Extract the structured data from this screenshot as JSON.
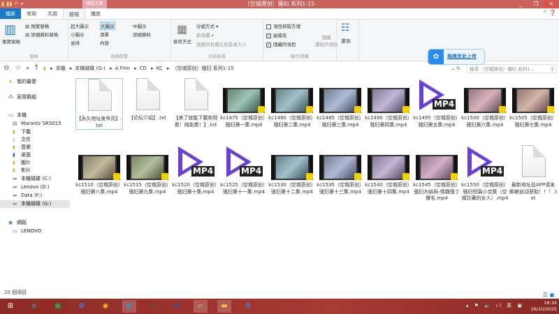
{
  "window": {
    "title": "（空城原创）骚妇 系列1-15",
    "context_tab": "視訊工具",
    "minimize": "_",
    "maximize": "❐",
    "close": "✕"
  },
  "tabs": [
    {
      "label": "檔案"
    },
    {
      "label": "常用"
    },
    {
      "label": "共用"
    },
    {
      "label": "檢視",
      "active": true
    },
    {
      "label": "播放"
    }
  ],
  "ribbon": {
    "pane": {
      "nav_pane": "瀏覽窗格",
      "preview": "預覽窗格",
      "details": "詳細資料窗格",
      "group": "窗格"
    },
    "layout": {
      "xl": "超大圖示",
      "large": "大圖示",
      "medium": "中圖示",
      "small": "小圖示",
      "list": "清單",
      "details": "詳細資料",
      "tiles": "並排",
      "content": "內容",
      "group": "版面配置",
      "selected": "大圖示"
    },
    "view": {
      "sort": "排序方式",
      "group_by": "分組方式 ▾",
      "add_col": "新增欄 ▾",
      "fit_cols": "調整所有欄位至最適大小",
      "group": "目前檢視"
    },
    "show": {
      "checkboxes": "項目核取方塊",
      "checkboxes_on": false,
      "ext": "副檔名",
      "ext_on": true,
      "hidden": "隱藏的項目",
      "hidden_on": true,
      "hide_sel": "隱藏",
      "hide_sel2": "選取的項目",
      "group": "顯示/隱藏"
    },
    "options": "選項"
  },
  "address": {
    "crumbs": [
      "本機",
      "本機磁碟 (G:)",
      "A Film",
      "CD",
      "KC",
      "（空城原创）骚妇 系列1-15"
    ],
    "search_placeholder": "搜尋 （空城原创）骚妇 系列1..."
  },
  "upload": {
    "label": "拖拽至此上传"
  },
  "sidebar": [
    {
      "label": "我的最愛",
      "icon": "star-icon"
    },
    {
      "label": "家用群組",
      "icon": "homegroup-icon"
    },
    {
      "label": "本機",
      "icon": "computer-icon"
    },
    {
      "label": "Marantz SR5015",
      "icon": "media-device-icon"
    },
    {
      "label": "下載",
      "icon": "downloads-icon"
    },
    {
      "label": "文件",
      "icon": "documents-icon"
    },
    {
      "label": "音樂",
      "icon": "music-icon"
    },
    {
      "label": "桌面",
      "icon": "desktop-icon"
    },
    {
      "label": "圖片",
      "icon": "pictures-icon"
    },
    {
      "label": "影片",
      "icon": "videos-icon"
    },
    {
      "label": "本機磁碟 (C:)",
      "icon": "drive-icon"
    },
    {
      "label": "Lenovo (D:)",
      "icon": "drive-icon"
    },
    {
      "label": "Data (F:)",
      "icon": "drive-icon"
    },
    {
      "label": "本機磁碟 (G:)",
      "icon": "drive-icon",
      "selected": true
    },
    {
      "label": "網路",
      "icon": "network-icon"
    },
    {
      "label": "LENOVO",
      "icon": "computer-icon"
    }
  ],
  "files": [
    {
      "name": "【永久地址发布页】.txt",
      "type": "txt"
    },
    {
      "name": "【论坛介绍】.txt",
      "type": "txt"
    },
    {
      "name": "【来了就能下載和观看！纯免费！】.txt",
      "type": "txt"
    },
    {
      "name": "kc1475（空城原创）骚妇第一集.mp4",
      "type": "video"
    },
    {
      "name": "kc1480（空城原创）骚妇第二集.mp4",
      "type": "video"
    },
    {
      "name": "kc1485（空城原创）骚妇第三集.mp4",
      "type": "video"
    },
    {
      "name": "kc1490（空城原创）骚妇第四集.mp4",
      "type": "video"
    },
    {
      "name": "kc1495（空城原创）骚妇第五集.mp4",
      "type": "mp4"
    },
    {
      "name": "kc1500（空城原创）骚妇第六集.mp4",
      "type": "video"
    },
    {
      "name": "kc1505（空城原创）骚妇第七集.mp4",
      "type": "video"
    },
    {
      "name": "kc1510（空城原创）骚妇第八集.mp4",
      "type": "video"
    },
    {
      "name": "kc1515（空城原创）骚妇第九集.mp4",
      "type": "video"
    },
    {
      "name": "kc1520（空城原创）骚妇第十集.mp4",
      "type": "mp4"
    },
    {
      "name": "kc1525（空城原创）骚妇第十一集.mp4",
      "type": "mp4"
    },
    {
      "name": "kc1530（空城原创）骚妇第十二集.mp4",
      "type": "video"
    },
    {
      "name": "kc1535（空城原创）骚妇第十三集.mp4",
      "type": "video"
    },
    {
      "name": "kc1540（空城原创）骚妇第十四集.mp4",
      "type": "video"
    },
    {
      "name": "kc1545（空城原创）骚妇大结局-情趣骚丁爆毛.mp4",
      "type": "video"
    },
    {
      "name": "kc1550（空城原创）骚妇短篇小合集（空城珍藏的女人）.mp4",
      "type": "mp4"
    },
    {
      "name": "最新地址及APP请发邮箱自动获取！！！.txt",
      "type": "txt"
    }
  ],
  "mp4_tag": "MP4",
  "status": {
    "count": "20 個項目"
  },
  "taskbar": {
    "apps": [
      "start-icon",
      "ie-icon",
      "store-icon",
      "baidu-netdisk-icon",
      "chrome-icon",
      "edge-icon",
      "excel-icon",
      "word-icon",
      "notepad-icon",
      "file-explorer-icon",
      "baidu-netdisk-icon"
    ],
    "ime": "英",
    "time": "18:34",
    "date": "26/10/2025"
  }
}
